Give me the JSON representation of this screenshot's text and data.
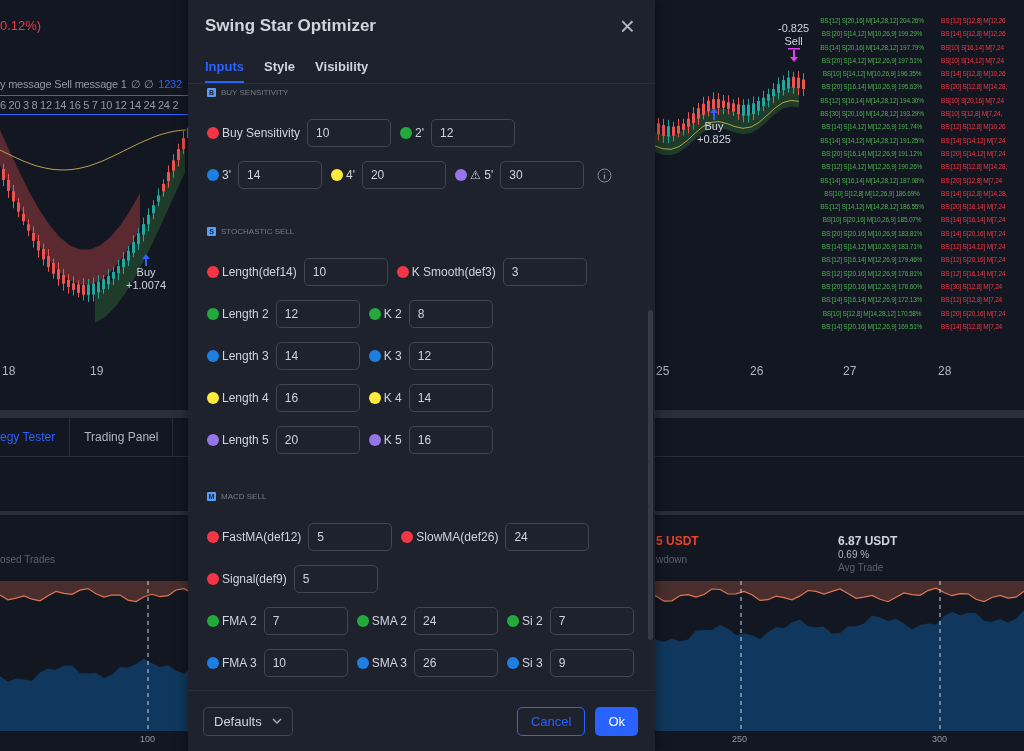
{
  "chart": {
    "change": "0.12%)",
    "legend": "y message Sell message 1",
    "legend_icons": [
      "∅",
      "∅"
    ],
    "legend_value": "1232",
    "number_row": "6 20 3 8 12 14 16 5 7 10 12 14 24 24 2",
    "left_dates": [
      "18",
      "19"
    ],
    "right_dates": [
      "25",
      "26",
      "27",
      "28"
    ],
    "signals": [
      {
        "kind": "buy",
        "label": "Buy",
        "value": "+1.0074"
      },
      {
        "kind": "buy",
        "label": "Buy",
        "value": "+0.825"
      },
      {
        "kind": "sell",
        "label": "Sell",
        "value": "-0.825"
      }
    ],
    "best_results": [
      "BS:[12] S[20,16] M[14,28,12] 204.26%",
      "BS:[20] S[14,12] M[10,26,9] 199.29%",
      "BS:[14] S[20,16] M[14,28,12] 197.79%",
      "BS:[20] S[14,12] M[12,26,9] 197.51%",
      "BS[10] S[14,12] M[10,26,9] 196.35%",
      "BS:[20] S[16,14] M[10,26,9] 195.63%",
      "BS:[12] S[16,14] M[14,28,12] 194.30%",
      "BS:[30] S[20,16] M[14,28,12] 193.29%",
      "BS:[14] S[14,12] M[12,26,9] 191.74%",
      "BS:[14] S[14,12] M[14,28,12] 191.25%",
      "BS:[20] S[16,14] M[12,26,9] 191.12%",
      "BS:[12] S[14,12] M[12,26,9] 190.26%",
      "BS:[14] S[16,14] M[14,28,12] 187.98%",
      "BS[10] S[12,8] M[12,26,9] 186.69%",
      "BS:[12] S[14,12] M[14,28,12] 186.55%",
      "BS[10] S[20,16] M[10,26,9] 185.07%",
      "BS:[20] S[20,16] M[10,26,9] 183.81%",
      "BS:[14] S[14,12] M[10,26,9] 183.71%",
      "BS:[12] S[16,14] M[12,26,9] 179.46%",
      "BS:[12] S[20,16] M[12,26,9] 176.81%",
      "BS:[20] S[20,16] M[12,26,9] 176.60%",
      "BS:[14] S[16,14] M[12,26,9] 172.13%",
      "BS[10] S[12,8] M[14,28,12] 170.58%",
      "BS:[14] S[20,16] M[12,26,9] 169.51%"
    ],
    "worst_results": [
      "BS:[12] S[12,8] M[12,26",
      "BS:[14] S[12,8] M[12,26",
      "BS[10] S[16,14] M[7,24",
      "BS[10] S[14,12] M[7,24",
      "BS:[14] S[12,8] M[10,26",
      "BS:[20] S[12,8] M[14,28,",
      "BS[10] S[20,16] M[7,24",
      "BS[10] S[12,8] M[7,24,",
      "BS:[12] S[12,8] M[10,26",
      "BS:[14] S[14,12] M[7,24",
      "BS:[20] S[14,12] M[7,24",
      "BS:[12] S[12,8] M[14,28,",
      "BS:[20] S[12,8] M[7,24",
      "BS:[14] S[12,8] M[14,28,",
      "BS:[20] S[16,14] M[7,24",
      "BS:[14] S[16,14] M[7,24",
      "BS:[14] S[20,16] M[7,24",
      "BS:[12] S[14,12] M[7,24",
      "BS:[12] S[20,16] M[7,24",
      "BS:[12] S[16,14] M[7,24",
      "BS:[30] S[12,8] M[7,24",
      "BS:[12] S[12,8] M[7,24",
      "BS:[20] S[20,16] M[7,24",
      "BS:[14] S[12,8] M[7,24"
    ]
  },
  "bottom_panel": {
    "tabs": [
      {
        "label": "egy Tester",
        "selected": true
      },
      {
        "label": "Trading Panel",
        "selected": false
      }
    ],
    "stats": [
      {
        "caption": "osed Trades"
      },
      {
        "value": "5 USDT",
        "negative": true,
        "caption": "wdown"
      },
      {
        "value": "6.87 USDT",
        "negative": false,
        "sub": "0.69 %",
        "caption": "Avg Trade"
      }
    ],
    "axis": [
      "100",
      "250",
      "300"
    ]
  },
  "dialog": {
    "title": "Swing Star Optimizer",
    "close": "×",
    "tabs": [
      {
        "label": "Inputs",
        "selected": true
      },
      {
        "label": "Style",
        "selected": false
      },
      {
        "label": "Visibility",
        "selected": false
      }
    ],
    "sections": [
      {
        "badge": "B",
        "title": "BUY SENSITIVITY",
        "rows": [
          {
            "fields": [
              {
                "color": "#f23645",
                "label": "Buy Sensitivity",
                "value": "10"
              },
              {
                "color": "#22ab3b",
                "label": "2'",
                "value": "12"
              }
            ]
          },
          {
            "info": true,
            "fields": [
              {
                "color": "#1e7fe0",
                "label": "3'",
                "value": "14"
              },
              {
                "color": "#ffeb3b",
                "label": "4'",
                "value": "20"
              },
              {
                "color": "#9575e8",
                "label": "⚠ 5'",
                "value": "30"
              }
            ]
          }
        ]
      },
      {
        "badge": "S",
        "title": "STOCHASTIC SELL",
        "rows": [
          {
            "fields": [
              {
                "color": "#f23645",
                "label": "Length(def14)",
                "value": "10"
              },
              {
                "color": "#f23645",
                "label": "K Smooth(def3)",
                "value": "3"
              }
            ]
          },
          {
            "fields": [
              {
                "color": "#22ab3b",
                "label": "Length 2",
                "value": "12"
              },
              {
                "color": "#22ab3b",
                "label": "K 2",
                "value": "8"
              }
            ]
          },
          {
            "fields": [
              {
                "color": "#1e7fe0",
                "label": "Length 3",
                "value": "14"
              },
              {
                "color": "#1e7fe0",
                "label": "K 3",
                "value": "12"
              }
            ]
          },
          {
            "fields": [
              {
                "color": "#ffeb3b",
                "label": "Length 4",
                "value": "16"
              },
              {
                "color": "#ffeb3b",
                "label": "K 4",
                "value": "14"
              }
            ]
          },
          {
            "fields": [
              {
                "color": "#9575e8",
                "label": "Length 5",
                "value": "20"
              },
              {
                "color": "#9575e8",
                "label": "K 5",
                "value": "16"
              }
            ]
          }
        ]
      },
      {
        "badge": "M",
        "title": "MACD SELL",
        "rows": [
          {
            "fields": [
              {
                "color": "#f23645",
                "label": "FastMA(def12)",
                "value": "5"
              },
              {
                "color": "#f23645",
                "label": "SlowMA(def26)",
                "value": "24"
              }
            ]
          },
          {
            "fields": [
              {
                "color": "#f23645",
                "label": "Signal(def9)",
                "value": "5"
              }
            ]
          },
          {
            "fields": [
              {
                "color": "#22ab3b",
                "label": "FMA 2",
                "value": "7"
              },
              {
                "color": "#22ab3b",
                "label": "SMA 2",
                "value": "24"
              },
              {
                "color": "#22ab3b",
                "label": "Si 2",
                "value": "7"
              }
            ]
          },
          {
            "fields": [
              {
                "color": "#1e7fe0",
                "label": "FMA 3",
                "value": "10"
              },
              {
                "color": "#1e7fe0",
                "label": "SMA 3",
                "value": "26"
              },
              {
                "color": "#1e7fe0",
                "label": "Si 3",
                "value": "9"
              }
            ]
          }
        ]
      }
    ],
    "footer": {
      "dropdown": "Defaults",
      "cancel": "Cancel",
      "ok": "Ok"
    }
  }
}
